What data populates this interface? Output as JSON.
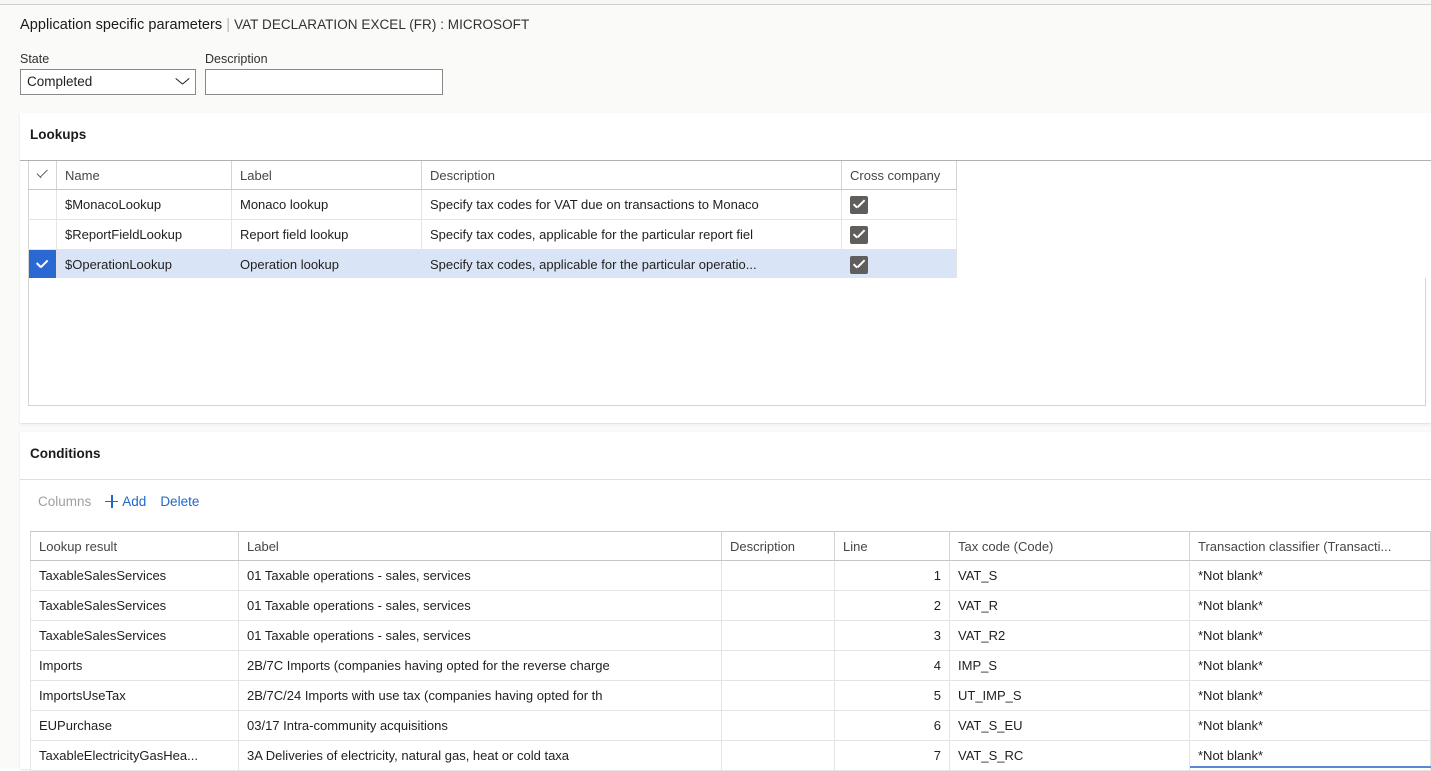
{
  "header": {
    "breadcrumb_main": "Application specific parameters",
    "breadcrumb_separator": "|",
    "breadcrumb_sub": "VAT DECLARATION EXCEL (FR) : MICROSOFT",
    "state_label": "State",
    "state_value": "Completed",
    "description_label": "Description",
    "description_value": "",
    "description_placeholder": ""
  },
  "lookups": {
    "title": "Lookups",
    "columns": [
      "",
      "Name",
      "Label",
      "Description",
      "Cross company"
    ],
    "rows": [
      {
        "selected": false,
        "name": "$MonacoLookup",
        "label": "Monaco lookup",
        "description": "Specify tax codes for VAT due on transactions to Monaco",
        "cross_company": true
      },
      {
        "selected": false,
        "name": "$ReportFieldLookup",
        "label": "Report field lookup",
        "description": "Specify tax codes, applicable for the particular report fiel",
        "cross_company": true
      },
      {
        "selected": true,
        "name": "$OperationLookup",
        "label": "Operation lookup",
        "description": "Specify tax codes, applicable for the particular operatio...",
        "cross_company": true
      }
    ]
  },
  "conditions": {
    "title": "Conditions",
    "toolbar": {
      "columns_label": "Columns",
      "add_label": "Add",
      "delete_label": "Delete"
    },
    "columns": [
      "Lookup result",
      "Label",
      "Description",
      "Line",
      "Tax code (Code)",
      "Transaction classifier (Transacti..."
    ],
    "rows": [
      {
        "lookup_result": "TaxableSalesServices",
        "label": "01 Taxable operations - sales, services",
        "description": "",
        "line": "1",
        "tax_code": "VAT_S",
        "transaction_classifier": "*Not blank*"
      },
      {
        "lookup_result": "TaxableSalesServices",
        "label": "01 Taxable operations - sales, services",
        "description": "",
        "line": "2",
        "tax_code": "VAT_R",
        "transaction_classifier": "*Not blank*"
      },
      {
        "lookup_result": "TaxableSalesServices",
        "label": "01 Taxable operations - sales, services",
        "description": "",
        "line": "3",
        "tax_code": "VAT_R2",
        "transaction_classifier": "*Not blank*"
      },
      {
        "lookup_result": "Imports",
        "label": "2B/7C Imports (companies having opted for the reverse charge",
        "description": "",
        "line": "4",
        "tax_code": "IMP_S",
        "transaction_classifier": "*Not blank*"
      },
      {
        "lookup_result": "ImportsUseTax",
        "label": "2B/7C/24 Imports with use tax (companies having opted for th",
        "description": "",
        "line": "5",
        "tax_code": "UT_IMP_S",
        "transaction_classifier": "*Not blank*"
      },
      {
        "lookup_result": "EUPurchase",
        "label": "03/17 Intra-community acquisitions",
        "description": "",
        "line": "6",
        "tax_code": "VAT_S_EU",
        "transaction_classifier": "*Not blank*"
      },
      {
        "lookup_result": "TaxableElectricityGasHea...",
        "label": "3A Deliveries of electricity, natural gas, heat or cold taxa",
        "description": "",
        "line": "7",
        "tax_code": "VAT_S_RC",
        "transaction_classifier": "*Not blank*"
      }
    ]
  },
  "colors": {
    "selection_blue": "#2a68d4",
    "selected_row": "#d9e5f7",
    "link_blue": "#2266cc",
    "checkbox_gray": "#605e5c",
    "page_background": "#fafaf9"
  }
}
